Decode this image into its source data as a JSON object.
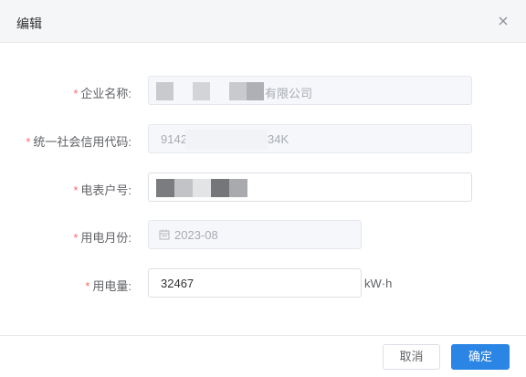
{
  "dialog": {
    "title": "编辑",
    "close_icon": "close-icon"
  },
  "form": {
    "company_name": {
      "required_mark": "*",
      "label": "企业名称:",
      "value_visible": "有限公司"
    },
    "credit_code": {
      "required_mark": "*",
      "label": "统一社会信用代码:",
      "value_part1": "9142",
      "value_part2": "34K"
    },
    "meter_no": {
      "required_mark": "*",
      "label": "电表户号:",
      "value": ""
    },
    "month": {
      "required_mark": "*",
      "label": "用电月份:",
      "value": "2023-08",
      "icon": "calendar-icon"
    },
    "usage": {
      "required_mark": "*",
      "label": "用电量:",
      "value": "32467",
      "unit": "kW·h"
    }
  },
  "footer": {
    "cancel_label": "取消",
    "ok_label": "确定"
  },
  "colors": {
    "primary": "#2b85e4",
    "required": "#f56c6c",
    "header_bg": "#f5f6f7"
  }
}
